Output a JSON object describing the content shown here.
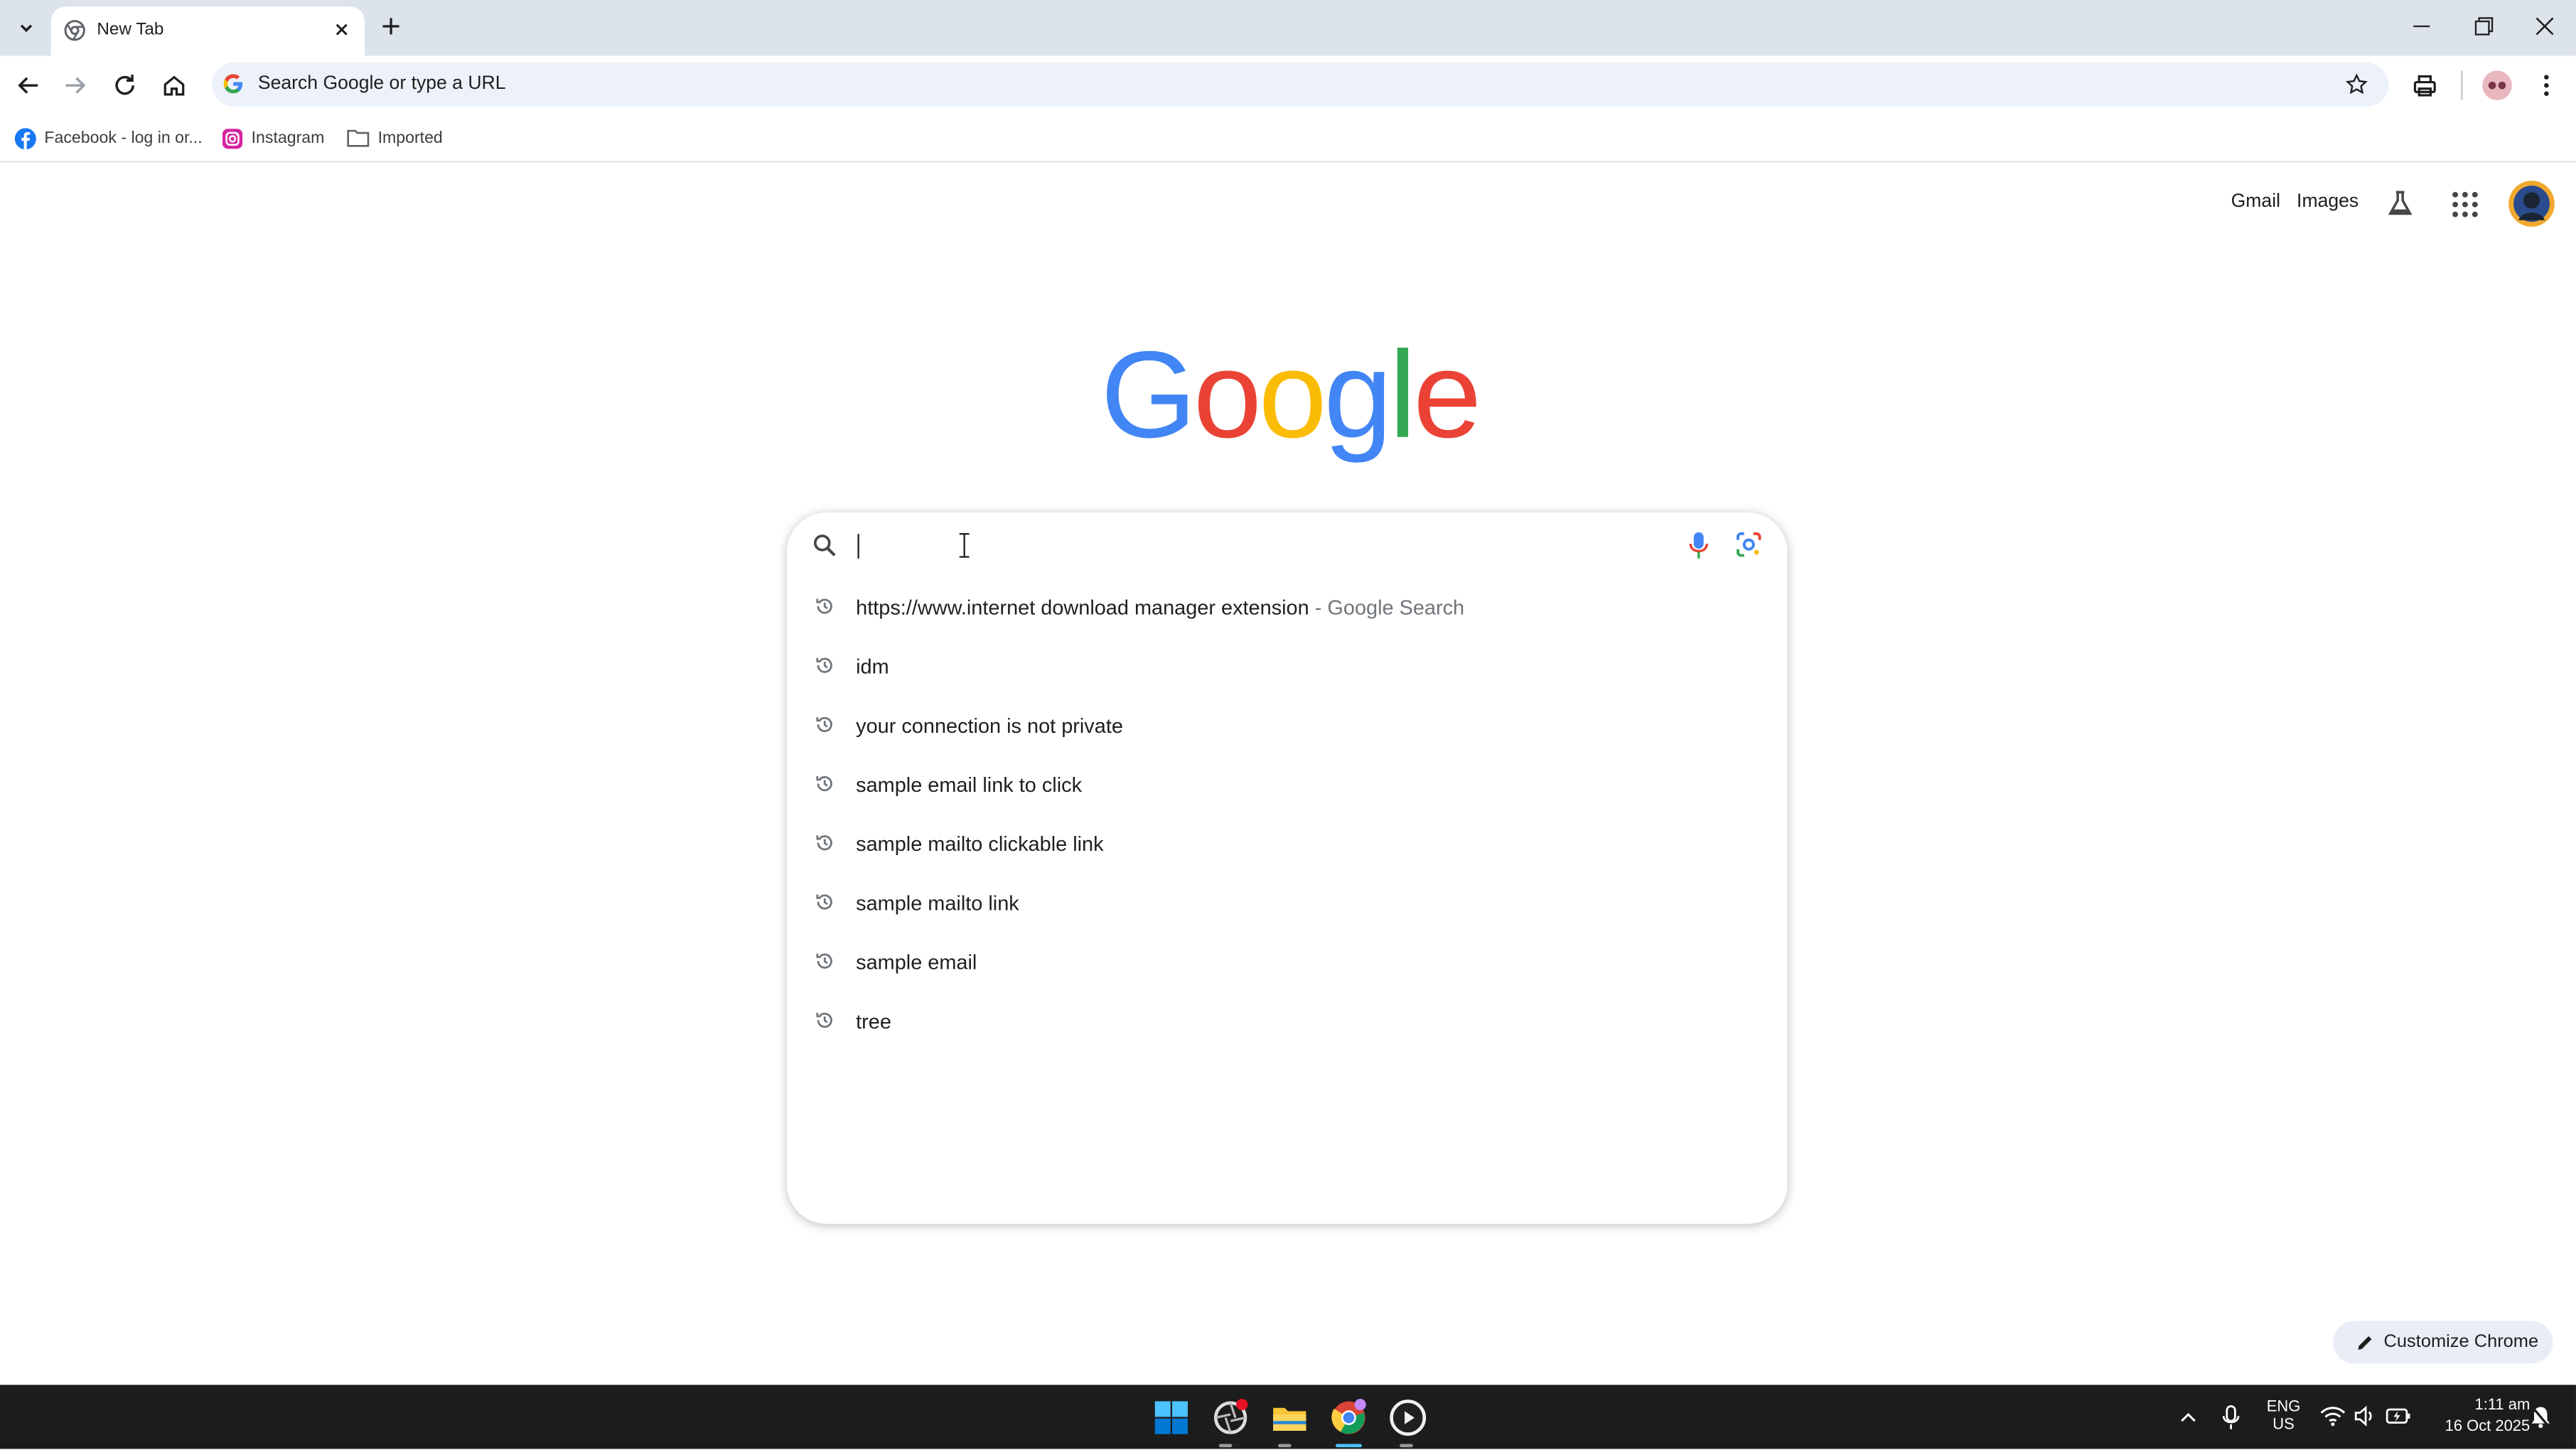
{
  "browser": {
    "tab_title": "New Tab",
    "omnibox_placeholder": "Search Google or type a URL"
  },
  "bookmarks": [
    {
      "label": "Facebook - log in or..."
    },
    {
      "label": "Instagram"
    },
    {
      "label": "Imported"
    }
  ],
  "header_links": {
    "gmail": "Gmail",
    "images": "Images"
  },
  "logo": {
    "letters": [
      "G",
      "o",
      "o",
      "g",
      "l",
      "e"
    ],
    "colors": [
      "#4285F4",
      "#EA4335",
      "#FBBC05",
      "#4285F4",
      "#34A853",
      "#EA4335"
    ]
  },
  "search": {
    "suggestions": [
      {
        "text": "https://www.internet download manager extension",
        "suffix": "- Google Search"
      },
      {
        "text": "idm"
      },
      {
        "text": "your connection is not private"
      },
      {
        "text": "sample email link to click"
      },
      {
        "text": "sample mailto clickable link"
      },
      {
        "text": "sample mailto link"
      },
      {
        "text": "sample email"
      },
      {
        "text": "tree"
      }
    ]
  },
  "customize_label": "Customize Chrome",
  "taskbar": {
    "lang_top": "ENG",
    "lang_bottom": "US",
    "time": "1:11 am",
    "date": "16 Oct 2025"
  }
}
